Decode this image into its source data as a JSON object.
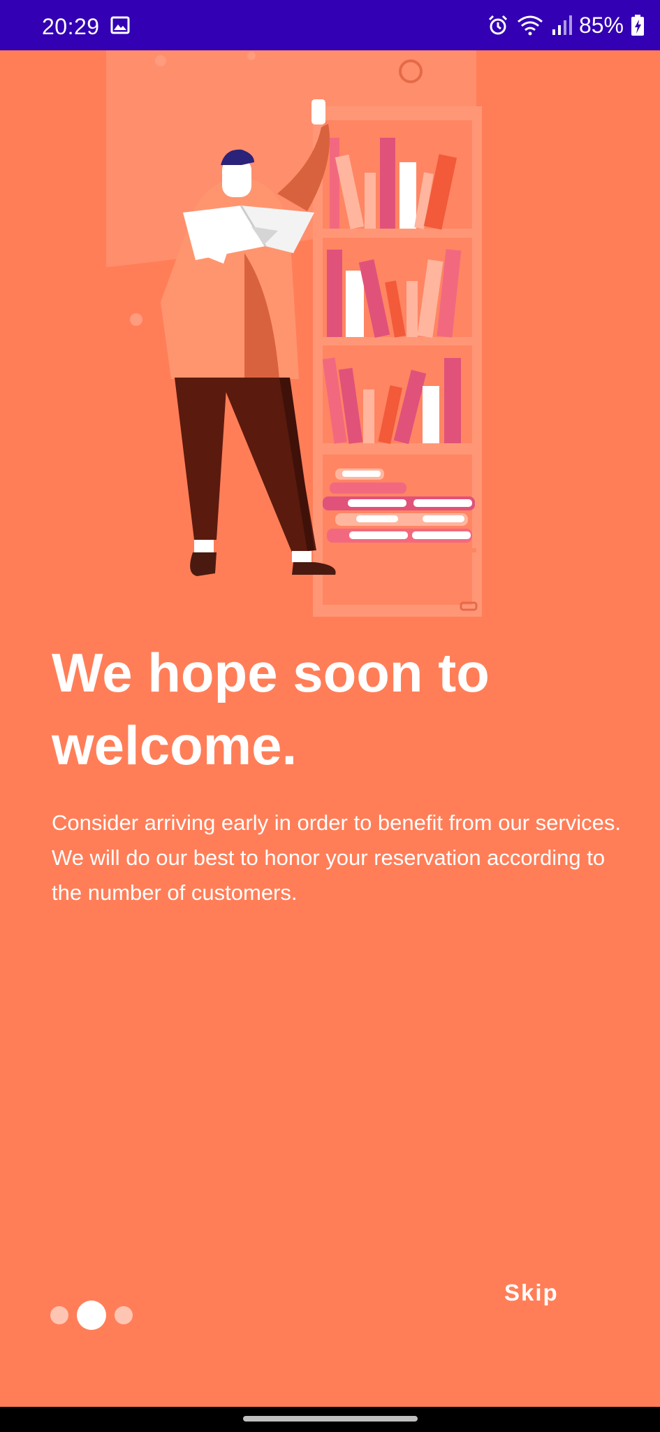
{
  "status_bar": {
    "time": "20:29",
    "battery_percent": "85%",
    "icons": [
      "gallery-icon",
      "alarm-icon",
      "wifi-icon",
      "signal-icon",
      "battery-charging-icon"
    ],
    "background": "#3300B3"
  },
  "onboarding": {
    "background": "#FF7E58",
    "title": "We hope soon to welcome.",
    "description": "Consider arriving early in order to benefit from our services. We will do our best to honor your reservation according to the number of customers.",
    "page_indicator": {
      "total": 3,
      "active": 2
    },
    "skip_label": "Skip"
  }
}
